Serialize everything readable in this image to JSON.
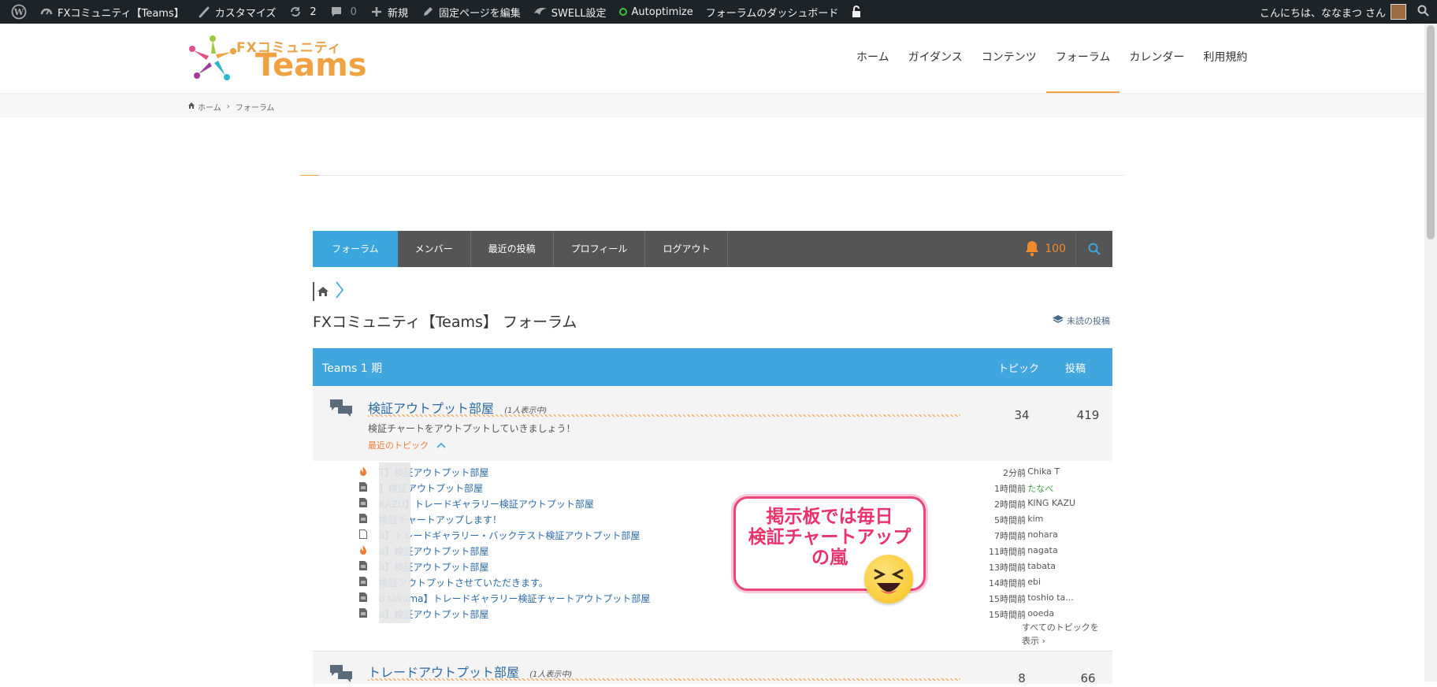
{
  "admin_bar": {
    "site_name": "FXコミュニティ【Teams】",
    "customize": "カスタマイズ",
    "updates_count": "2",
    "comments_count": "0",
    "new": "新規",
    "edit_page": "固定ページを編集",
    "swell": "SWELL設定",
    "autoptimize": "Autoptimize",
    "forum_dashboard": "フォーラムのダッシュボード",
    "greeting": "こんにちは、ななまつ さん"
  },
  "site": {
    "logo_small": "FXコミュニティ",
    "logo_big": "Teams",
    "nav": [
      "ホーム",
      "ガイダンス",
      "コンテンツ",
      "フォーラム",
      "カレンダー",
      "利用規約"
    ],
    "breadcrumb": [
      "ホーム",
      "フォーラム"
    ]
  },
  "forum_nav": {
    "items": [
      "フォーラム",
      "メンバー",
      "最近の投稿",
      "プロフィール",
      "ログアウト"
    ],
    "notification_count": "100"
  },
  "forum": {
    "title": "FXコミュニティ【Teams】 フォーラム",
    "unread_link": "未読の投稿",
    "category": {
      "name": "Teams 1 期",
      "col_topics": "トピック",
      "col_posts": "投稿"
    },
    "forums": [
      {
        "title": "検証アウトプット部屋",
        "viewing": "(1人表示中)",
        "description": "検証チャートをアウトプットしていきましょう！",
        "recent_label": "最近のトピック",
        "topics": "34",
        "posts": "419"
      },
      {
        "title": "トレードアウトプット部屋",
        "viewing": "(1人表示中)",
        "topics": "8",
        "posts": "66"
      }
    ],
    "recent_topics": [
      {
        "name": "T】検証アウトプット部屋",
        "time": "2分前",
        "user": ": Chika T",
        "icon": "hot"
      },
      {
        "name": "】検証アウトプット部屋",
        "time": "1時間前",
        "user": ": たなべ",
        "icon": "doc"
      },
      {
        "name": "KAZU】トレードギャラリー検証アウトプット部屋",
        "time": "2時間前",
        "user": ": KING KAZU",
        "icon": "doc"
      },
      {
        "name": "検証チャートアップします！",
        "time": "5時間前",
        "user": ": kim",
        "icon": "doc"
      },
      {
        "name": "a】トレードギャラリー・バックテスト検証アウトプット部屋",
        "time": "7時間前",
        "user": ": nohara",
        "icon": "doc-outline"
      },
      {
        "name": "a】検証アウトプット部屋",
        "time": "11時間前",
        "user": ": nagata",
        "icon": "hot"
      },
      {
        "name": "a】検証アウトプット部屋",
        "time": "13時間前",
        "user": ": tabata",
        "icon": "doc"
      },
      {
        "name": "検証アウトプットさせていただきます。",
        "time": "14時間前",
        "user": ": ebi",
        "icon": "doc"
      },
      {
        "name": "o takuma】トレードギャラリー検証チャートアウトプット部屋",
        "time": "15時間前",
        "user": ": toshio ta...",
        "icon": "doc"
      },
      {
        "name": "a】検証アウトプット部屋",
        "time": "15時間前",
        "user": ": ooeda",
        "icon": "doc"
      }
    ],
    "see_all_line1": "すべてのトピックを",
    "see_all_line2": "表示 ›"
  },
  "callout": {
    "line1": "掲示板では毎日",
    "line2": "検証チャートアップ",
    "line3": "の嵐"
  },
  "colors": {
    "accent_blue": "#41a6de",
    "accent_orange": "#f0a242",
    "callout_pink": "#e8336b"
  }
}
